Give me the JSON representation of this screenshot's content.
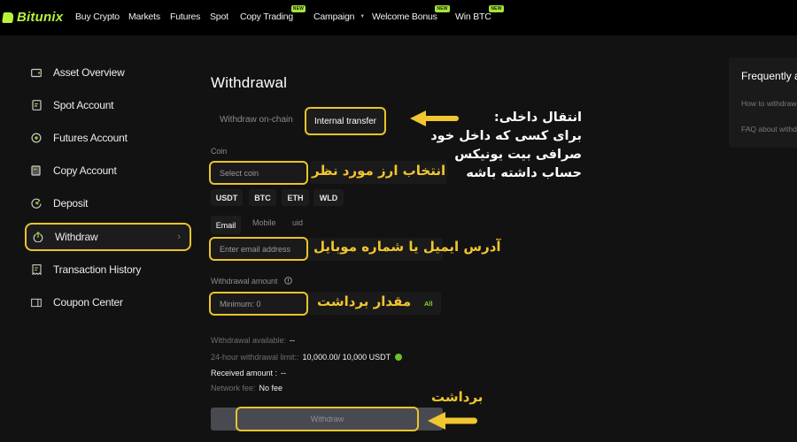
{
  "brand": {
    "name": "Bitunix",
    "accent": "#b7f33a",
    "highlight": "#e9c42a"
  },
  "nav": {
    "items": [
      {
        "label": "Buy Crypto"
      },
      {
        "label": "Markets"
      },
      {
        "label": "Futures"
      },
      {
        "label": "Spot"
      },
      {
        "label": "Copy Trading",
        "badge": "NEW"
      },
      {
        "label": "Campaign",
        "dropdown": true
      },
      {
        "label": "Welcome Bonus",
        "badge": "NEW"
      },
      {
        "label": "Win BTC",
        "badge": "NEW"
      }
    ]
  },
  "sidebar": {
    "items": [
      {
        "label": "Asset Overview",
        "icon": "wallet-icon"
      },
      {
        "label": "Spot Account",
        "icon": "document-icon"
      },
      {
        "label": "Futures Account",
        "icon": "target-icon"
      },
      {
        "label": "Copy Account",
        "icon": "copy-icon"
      },
      {
        "label": "Deposit",
        "icon": "deposit-icon"
      },
      {
        "label": "Withdraw",
        "icon": "withdraw-icon",
        "active": true
      },
      {
        "label": "Transaction History",
        "icon": "receipt-icon"
      },
      {
        "label": "Coupon Center",
        "icon": "coupon-icon"
      }
    ]
  },
  "main": {
    "title": "Withdrawal",
    "tabs": [
      {
        "label": "Withdraw on-chain"
      },
      {
        "label": "Internal transfer",
        "active": true
      }
    ],
    "coin": {
      "label": "Coin",
      "placeholder": "Select coin",
      "quick_picks": [
        "USDT",
        "BTC",
        "ETH",
        "WLD"
      ]
    },
    "recipient": {
      "tabs": [
        "Email",
        "Mobile",
        "uid"
      ],
      "active_tab": "Email",
      "placeholder": "Enter email address"
    },
    "amount": {
      "label": "Withdrawal amount",
      "placeholder": "Minimum: 0",
      "all_label": "All"
    },
    "info": {
      "available_label": "Withdrawal available:",
      "available_value": "--",
      "limit_label": "24-hour withdrawal limit::",
      "limit_value": "10,000.00/ 10,000 USDT",
      "received_label": "Received amount :",
      "received_value": "--",
      "fee_label": "Network fee:",
      "fee_value": "No fee"
    },
    "submit_label": "Withdraw"
  },
  "faq": {
    "title": "Frequently asked questions",
    "items": [
      "How to withdraw",
      "FAQ about withdrawal"
    ]
  },
  "annotations": {
    "internal_transfer": [
      "انتقال داخلی:",
      "برای کسی که داخل خود",
      "صرافی بیت یونیکس",
      "حساب داشته باشه"
    ],
    "select_coin": "انتخاب ارز مورد نظر",
    "recipient": "آدرس ایمیل  یا شماره موبایل",
    "amount": "مقدار برداشت",
    "withdraw": "برداشت"
  }
}
